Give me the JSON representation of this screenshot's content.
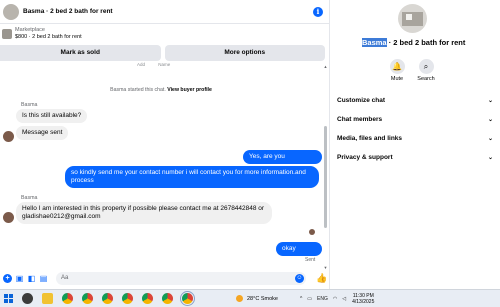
{
  "header": {
    "title": "Basma · 2 bed 2 bath for rent",
    "info_icon": "i"
  },
  "listing": {
    "source": "Marketplace",
    "price_title": "$800 · 2 bed 2 bath for rent"
  },
  "actions": {
    "mark_sold": "Mark as sold",
    "more_options": "More options"
  },
  "cutoff_text": [
    "Add",
    "Name"
  ],
  "system_note": {
    "prefix": "Basma started this chat.",
    "link": "View buyer profile"
  },
  "messages": [
    {
      "sender": "Basma",
      "text": "Is this still available?"
    },
    {
      "text": "Message sent"
    },
    {
      "text": "Yes, are you interested?"
    },
    {
      "text_line1": "so kindly send me your contact number i will contact  you for more information.and",
      "text_line2": "process"
    },
    {
      "sender": "Basma",
      "text_line1": "Hello I am interested in this property if possible please contact me at 2678442848 or",
      "text_line2": "gladishae0212@gmail.com"
    },
    {
      "text": "okay thanks"
    }
  ],
  "sent_status": "Sent",
  "composer": {
    "placeholder": "Aa",
    "icons": [
      "plus-icon",
      "image-icon",
      "sticker-icon",
      "gif-icon",
      "emoji-icon",
      "like-icon"
    ]
  },
  "info_panel": {
    "title_selected": "Basma",
    "title_rest": " · 2 bed 2 bath for rent",
    "mute_label": "Mute",
    "search_label": "Search",
    "sections": [
      "Customize chat",
      "Chat members",
      "Media, files and links",
      "Privacy & support"
    ]
  },
  "taskbar": {
    "weather": "28°C  Smoke",
    "lang": "ENG",
    "time": "11:30 PM",
    "date": "4/13/2025"
  },
  "colors": {
    "accent": "#0866ff",
    "bubble_in": "#f0f0f0",
    "button_bg": "#e4e6eb"
  }
}
